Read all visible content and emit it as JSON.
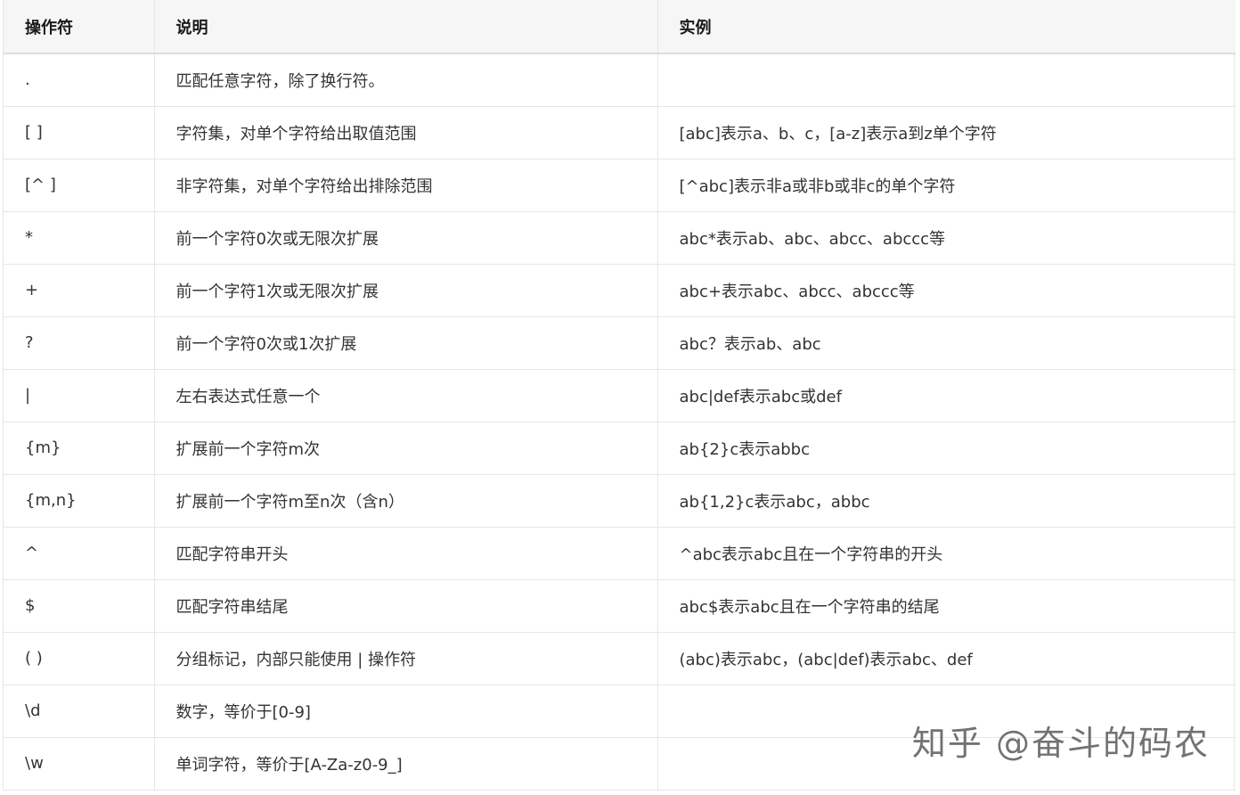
{
  "table": {
    "headers": [
      "操作符",
      "说明",
      "实例"
    ],
    "rows": [
      {
        "op": ".",
        "desc": "匹配任意字符，除了换行符。",
        "example": ""
      },
      {
        "op": "[ ]",
        "desc": "字符集，对单个字符给出取值范围",
        "example": "[abc]表示a、b、c，[a-z]表示a到z单个字符"
      },
      {
        "op": "[^ ]",
        "desc": "非字符集，对单个字符给出排除范围",
        "example": "[^abc]表示非a或非b或非c的单个字符"
      },
      {
        "op": "*",
        "desc": "前一个字符0次或无限次扩展",
        "example": "abc*表示ab、abc、abcc、abccc等"
      },
      {
        "op": "+",
        "desc": "前一个字符1次或无限次扩展",
        "example": "abc+表示abc、abcc、abccc等"
      },
      {
        "op": "?",
        "desc": "前一个字符0次或1次扩展",
        "example": "abc？表示ab、abc"
      },
      {
        "op": "|",
        "desc": "左右表达式任意一个",
        "example": "abc|def表示abc或def"
      },
      {
        "op": "{m}",
        "desc": "扩展前一个字符m次",
        "example": "ab{2}c表示abbc"
      },
      {
        "op": "{m,n}",
        "desc": "扩展前一个字符m至n次（含n）",
        "example": "ab{1,2}c表示abc，abbc"
      },
      {
        "op": "^",
        "desc": "匹配字符串开头",
        "example": "^abc表示abc且在一个字符串的开头"
      },
      {
        "op": "$",
        "desc": "匹配字符串结尾",
        "example": "abc$表示abc且在一个字符串的结尾"
      },
      {
        "op": "( )",
        "desc": "分组标记，内部只能使用 | 操作符",
        "example": "(abc)表示abc，(abc|def)表示abc、def"
      },
      {
        "op": "\\d",
        "desc": "数字，等价于[0-9]",
        "example": ""
      },
      {
        "op": "\\w",
        "desc": "单词字符，等价于[A-Za-z0-9_]",
        "example": ""
      }
    ]
  },
  "watermark": "知乎 @奋斗的码农"
}
